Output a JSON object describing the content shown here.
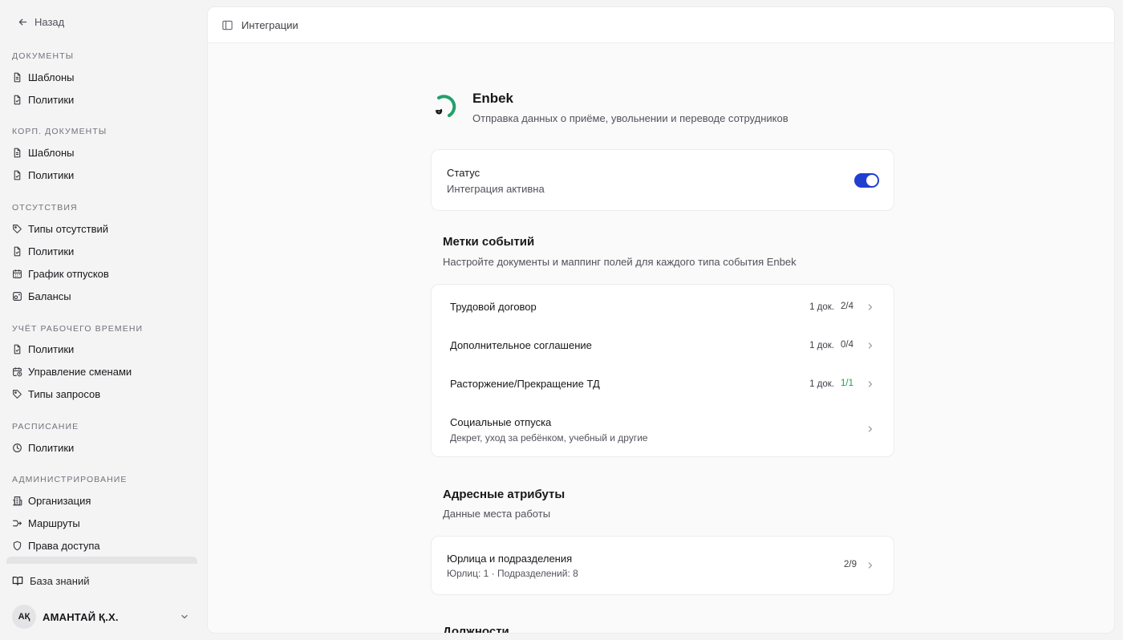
{
  "sidebar": {
    "back_label": "Назад",
    "groups": [
      {
        "title": "Документы",
        "items": [
          {
            "label": "Шаблоны",
            "icon": "file-icon"
          },
          {
            "label": "Политики",
            "icon": "file-check-icon"
          }
        ]
      },
      {
        "title": "Корп. документы",
        "items": [
          {
            "label": "Шаблоны",
            "icon": "file-icon"
          },
          {
            "label": "Политики",
            "icon": "file-check-icon"
          }
        ]
      },
      {
        "title": "Отсутствия",
        "items": [
          {
            "label": "Типы отсутствий",
            "icon": "tag-icon"
          },
          {
            "label": "Политики",
            "icon": "file-check-icon"
          },
          {
            "label": "График отпусков",
            "icon": "calendar-icon"
          },
          {
            "label": "Балансы",
            "icon": "scale-icon"
          }
        ]
      },
      {
        "title": "Учёт рабочего времени",
        "items": [
          {
            "label": "Политики",
            "icon": "file-check-icon"
          },
          {
            "label": "Управление сменами",
            "icon": "calendar-clock-icon"
          },
          {
            "label": "Типы запросов",
            "icon": "tag-icon"
          }
        ]
      },
      {
        "title": "Расписание",
        "items": [
          {
            "label": "Политики",
            "icon": "clock-icon"
          }
        ]
      },
      {
        "title": "Администрирование",
        "items": [
          {
            "label": "Организация",
            "icon": "building-icon"
          },
          {
            "label": "Маршруты",
            "icon": "route-icon"
          },
          {
            "label": "Права доступа",
            "icon": "shield-icon"
          }
        ]
      }
    ],
    "knowledge_base": "База знаний",
    "user": {
      "initials": "АҚ",
      "name": "АМАНТАЙ Қ.Х."
    }
  },
  "topbar": {
    "breadcrumb": "Интеграции"
  },
  "integration": {
    "name": "Enbek",
    "description": "Отправка данных о приёме, увольнении и переводе сотрудников",
    "accent_color": "#22a06b"
  },
  "status": {
    "title": "Статус",
    "subtitle": "Интеграция активна",
    "enabled": true,
    "switch_color": "#1f3fd1"
  },
  "events": {
    "title": "Метки событий",
    "subtitle": "Настройте документы и маппинг полей для каждого типа события Enbek",
    "rows": [
      {
        "label": "Трудовой договор",
        "docs": "1 док.",
        "mapped": "2/4",
        "complete": false
      },
      {
        "label": "Дополнительное соглашение",
        "docs": "1 док.",
        "mapped": "0/4",
        "complete": false
      },
      {
        "label": "Расторжение/Прекращение ТД",
        "docs": "1 док.",
        "mapped": "1/1",
        "complete": true
      },
      {
        "label": "Социальные отпуска",
        "sublabel": "Декрет, уход за ребёнком, учебный и другие"
      }
    ]
  },
  "address": {
    "title": "Адресные атрибуты",
    "subtitle": "Данные места работы",
    "row": {
      "label": "Юрлица и подразделения",
      "sublabel": "Юрлиц: 1 · Подразделений: 8",
      "mapped": "2/9"
    }
  },
  "positions": {
    "title": "Должности"
  }
}
